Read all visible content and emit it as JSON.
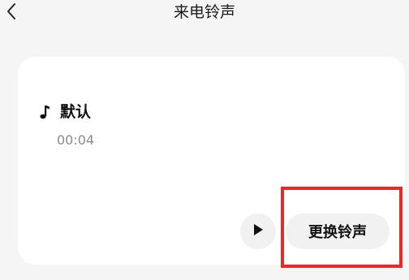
{
  "header": {
    "title": "来电铃声",
    "back_icon": "chevron-left-icon"
  },
  "ringtone": {
    "icon": "music-note-icon",
    "name": "默认",
    "duration": "00:04"
  },
  "actions": {
    "play_icon": "play-icon",
    "change_label": "更换铃声"
  },
  "colors": {
    "background": "#f5f5f5",
    "card": "#ffffff",
    "button": "#f1f1f1",
    "highlight": "#e8282d"
  }
}
